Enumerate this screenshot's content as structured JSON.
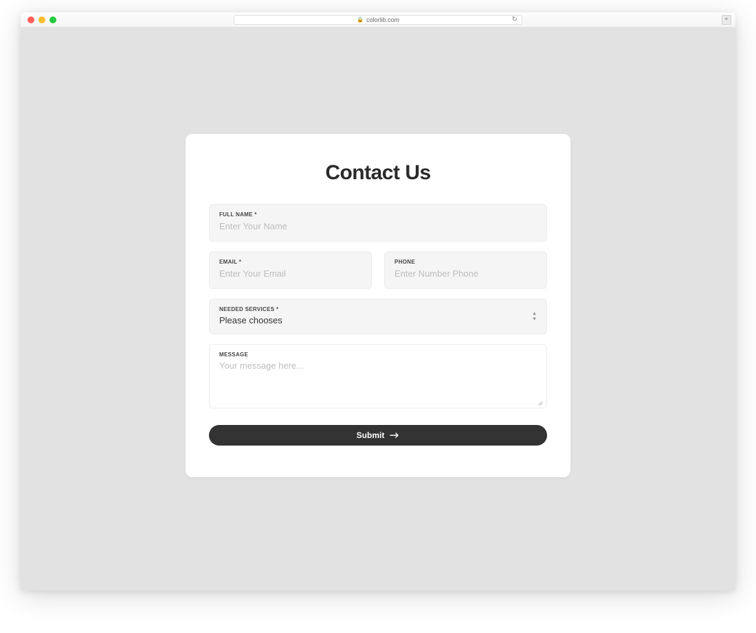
{
  "browser": {
    "url": "colorlib.com"
  },
  "form": {
    "title": "Contact Us",
    "full_name": {
      "label": "FULL NAME *",
      "placeholder": "Enter Your Name",
      "value": ""
    },
    "email": {
      "label": "EMAIL *",
      "placeholder": "Enter Your Email",
      "value": ""
    },
    "phone": {
      "label": "PHONE",
      "placeholder": "Enter Number Phone",
      "value": ""
    },
    "services": {
      "label": "NEEDED SERVICES *",
      "value": "Please chooses"
    },
    "message": {
      "label": "MESSAGE",
      "placeholder": "Your message here...",
      "value": ""
    },
    "submit_label": "Submit"
  }
}
